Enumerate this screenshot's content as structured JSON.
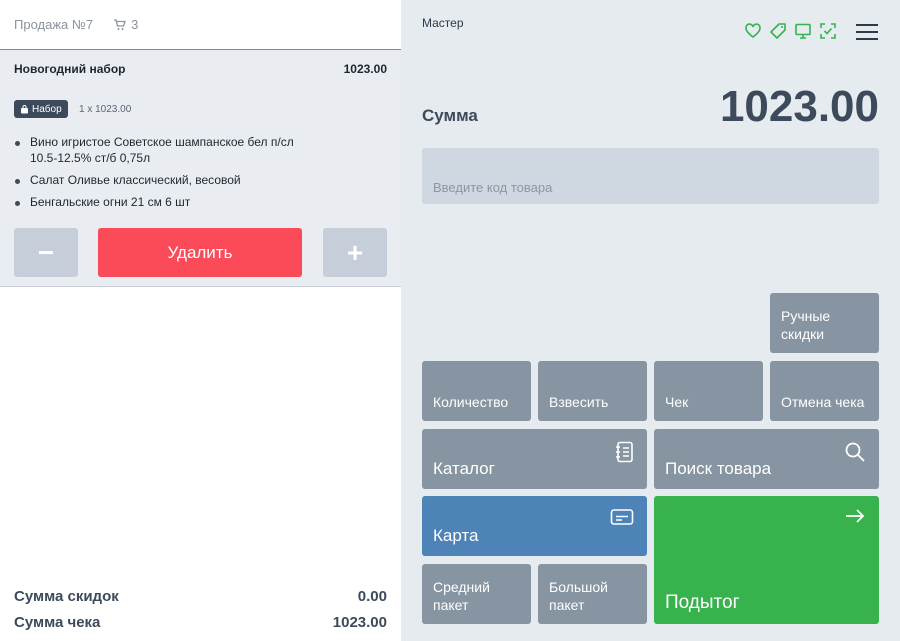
{
  "left": {
    "sale_title": "Продажа №7",
    "cart_count": "3",
    "item": {
      "name": "Новогодний набор",
      "price": "1023.00",
      "badge": "Набор",
      "qty": "1 x 1023.00",
      "components": [
        "Вино игристое Советское шампанское бел п/сл 10.5-12.5% ст/б 0,75л",
        "Салат Оливье классический, весовой",
        "Бенгальские огни 21 см 6 шт"
      ]
    },
    "minus_label": "−",
    "delete_label": "Удалить",
    "plus_label": "+",
    "discount_label": "Сумма скидок",
    "discount_value": "0.00",
    "check_label": "Сумма чека",
    "check_value": "1023.00"
  },
  "right": {
    "mode": "Мастер",
    "status_icons": [
      "heart-icon",
      "tag-icon",
      "monitor-icon",
      "scan-check-icon"
    ],
    "sum_label": "Сумма",
    "sum_value": "1023.00",
    "code_placeholder": "Введите код товара",
    "keys": {
      "manual_discount": "Ручные скидки",
      "quantity": "Количество",
      "weigh": "Взвесить",
      "receipt": "Чек",
      "cancel_receipt": "Отмена чека",
      "catalog": "Каталог",
      "search": "Поиск товара",
      "card": "Карта",
      "medium_bag": "Средний пакет",
      "large_bag": "Большой пакет",
      "subtotal": "Подытог"
    }
  },
  "colors": {
    "accent_green": "#37b24d",
    "delete_red": "#fb4b59",
    "card_blue": "#4d83b7",
    "key_gray": "#8794a1"
  }
}
